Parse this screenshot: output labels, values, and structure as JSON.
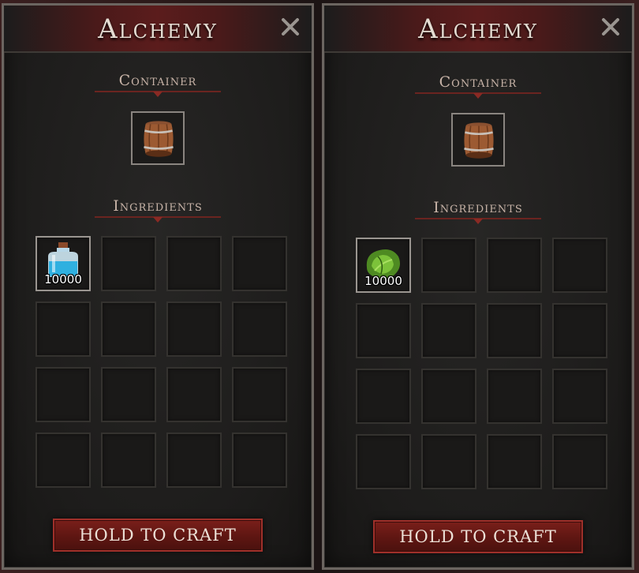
{
  "panels": [
    {
      "title": "Alchemy",
      "container_label": "Container",
      "container_item": "barrel-icon",
      "ingredients_label": "Ingredients",
      "ingredients": [
        {
          "icon": "water-bottle-icon",
          "quantity": "10000"
        }
      ],
      "craft_label": "HOLD TO CRAFT"
    },
    {
      "title": "Alchemy",
      "container_label": "Container",
      "container_item": "barrel-icon",
      "ingredients_label": "Ingredients",
      "ingredients": [
        {
          "icon": "green-herb-icon",
          "quantity": "10000"
        }
      ],
      "craft_label": "HOLD TO CRAFT"
    }
  ],
  "colors": {
    "title_bar_red": "#5b1c1c",
    "button_red": "#6e1b16",
    "slot_border": "#34322f"
  }
}
